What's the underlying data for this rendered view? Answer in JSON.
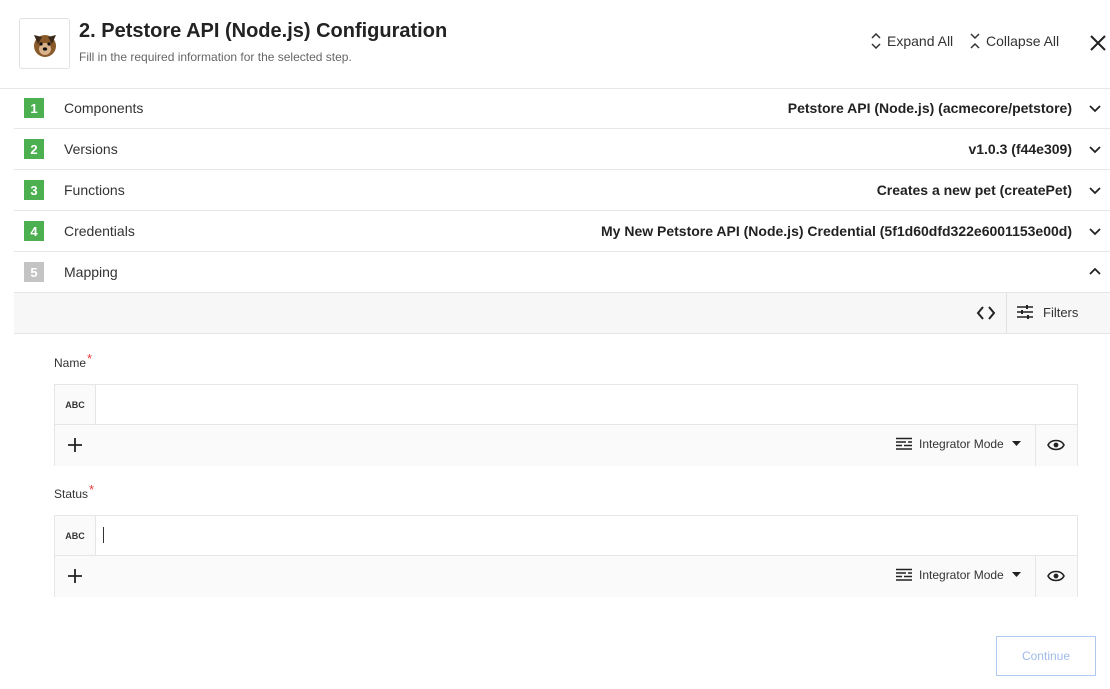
{
  "header": {
    "title": "2. Petstore API (Node.js) Configuration",
    "subtitle": "Fill in the required information for the selected step.",
    "expand_all": "Expand All",
    "collapse_all": "Collapse All"
  },
  "steps": [
    {
      "number": "1",
      "label": "Components",
      "value": "Petstore API (Node.js) (acmecore/petstore)",
      "status": "complete"
    },
    {
      "number": "2",
      "label": "Versions",
      "value": "v1.0.3 (f44e309)",
      "status": "complete"
    },
    {
      "number": "3",
      "label": "Functions",
      "value": "Creates a new pet (createPet)",
      "status": "complete"
    },
    {
      "number": "4",
      "label": "Credentials",
      "value": "My New Petstore API (Node.js) Credential (5f1d60dfd322e6001153e00d)",
      "status": "complete"
    },
    {
      "number": "5",
      "label": "Mapping",
      "value": "",
      "status": "active"
    }
  ],
  "toolbar": {
    "filters_label": "Filters"
  },
  "fields": [
    {
      "label": "Name",
      "required_mark": "*",
      "type_badge": "ABC",
      "value": "",
      "mode": "Integrator Mode"
    },
    {
      "label": "Status",
      "required_mark": "*",
      "type_badge": "ABC",
      "value": "",
      "mode": "Integrator Mode"
    }
  ],
  "continue_label": "Continue",
  "colors": {
    "complete": "#4caf50",
    "pending": "#c4c4c4",
    "required": "#e53935",
    "continue_border": "#b0c9f0"
  }
}
